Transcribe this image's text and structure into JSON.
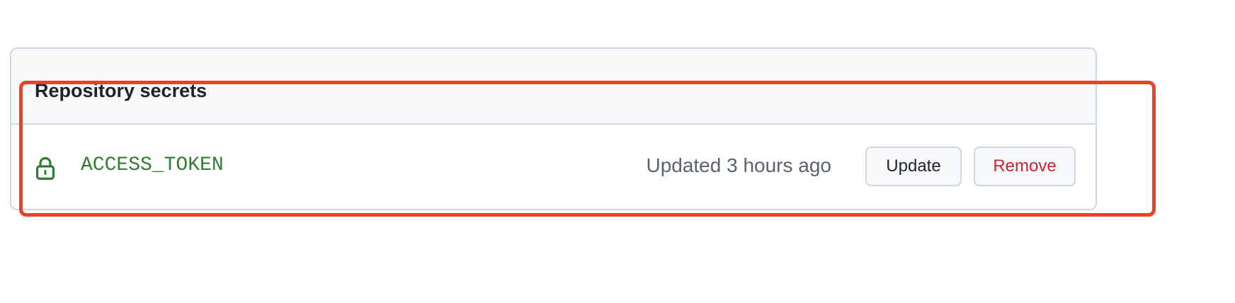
{
  "secrets_panel": {
    "title": "Repository secrets",
    "secrets": [
      {
        "name": "ACCESS_TOKEN",
        "updated": "Updated 3 hours ago",
        "icon": "lock-icon",
        "update_label": "Update",
        "remove_label": "Remove"
      }
    ]
  },
  "colors": {
    "secret_name": "#2f7d32",
    "remove_text": "#cf222e",
    "highlight": "#e8412c",
    "header_bg": "#f6f8fa",
    "border": "#d0d7de"
  }
}
